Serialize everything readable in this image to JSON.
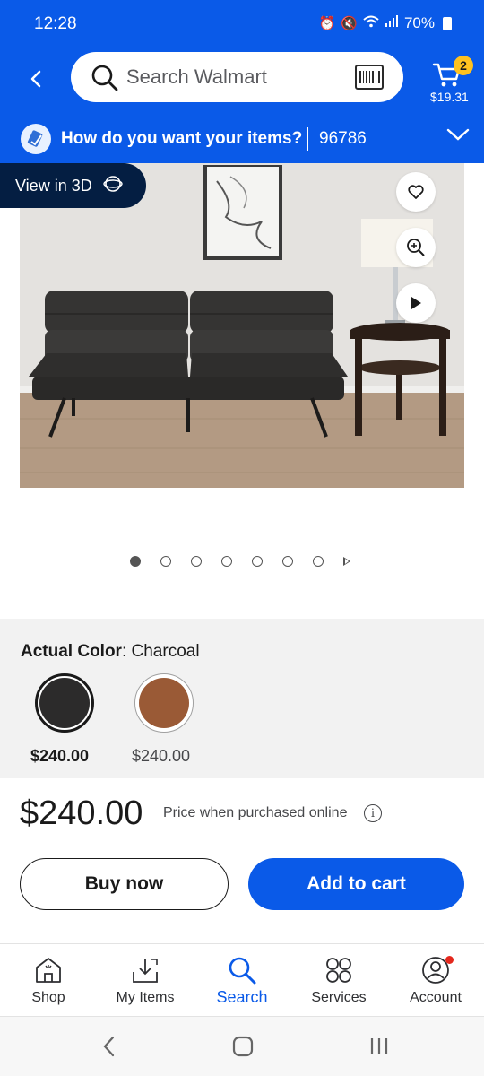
{
  "status_bar": {
    "time": "12:28",
    "battery": "70%"
  },
  "header": {
    "search_placeholder": "Search Walmart",
    "cart_count": "2",
    "cart_total": "$19.31"
  },
  "delivery": {
    "question": "How do you want your items?",
    "zip": "96786"
  },
  "media": {
    "view_3d_label": "View in 3D",
    "dot_count": 7,
    "active_dot": 0
  },
  "variants": {
    "label_key": "Actual Color",
    "label_sep": ": ",
    "label_value": "Charcoal",
    "options": [
      {
        "name": "charcoal",
        "color": "#2c2b2b",
        "price": "$240.00",
        "selected": true
      },
      {
        "name": "brown",
        "color": "#9a5a36",
        "price": "$240.00",
        "selected": false
      }
    ]
  },
  "price": {
    "amount": "$240.00",
    "note": "Price when purchased online",
    "info_glyph": "i"
  },
  "actions": {
    "buy_now": "Buy now",
    "add_to_cart": "Add to cart"
  },
  "bottom_nav": {
    "items": [
      {
        "label": "Shop",
        "icon": "shop-icon",
        "active": false
      },
      {
        "label": "My Items",
        "icon": "my-items-icon",
        "active": false
      },
      {
        "label": "Search",
        "icon": "search-icon",
        "active": true
      },
      {
        "label": "Services",
        "icon": "services-icon",
        "active": false
      },
      {
        "label": "Account",
        "icon": "account-icon",
        "active": false
      }
    ]
  },
  "colors": {
    "brand_blue": "#0a5ae8",
    "navy": "#041e42",
    "spark_yellow": "#ffc220",
    "notification_red": "#e4281d"
  }
}
